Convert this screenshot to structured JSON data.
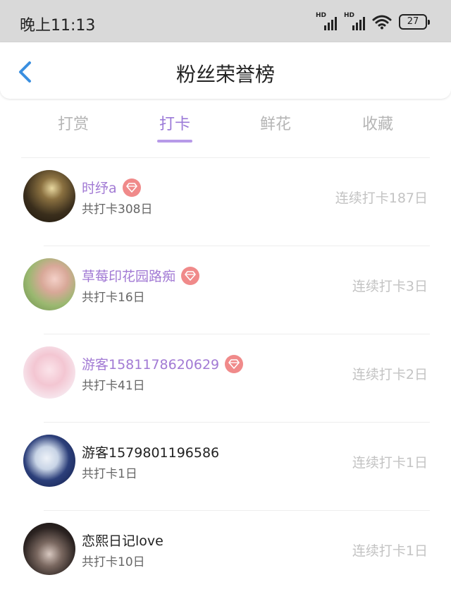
{
  "status": {
    "time": "晚上11:13",
    "battery": "27",
    "sim1": "HD",
    "sim2": "HD"
  },
  "header": {
    "title": "粉丝荣誉榜"
  },
  "tabs": [
    {
      "label": "打赏",
      "active": false
    },
    {
      "label": "打卡",
      "active": true
    },
    {
      "label": "鲜花",
      "active": false
    },
    {
      "label": "收藏",
      "active": false
    }
  ],
  "colors": {
    "accent": "#9b7ad8",
    "vip_name": "#a27ad4",
    "badge": "#f08a8a"
  },
  "fans": [
    {
      "name": "时纾a",
      "total": "共打卡308日",
      "streak": "连续打卡187日",
      "vip": true
    },
    {
      "name": "草莓印花园路痴",
      "total": "共打卡16日",
      "streak": "连续打卡3日",
      "vip": true
    },
    {
      "name": "游客1581178620629",
      "total": "共打卡41日",
      "streak": "连续打卡2日",
      "vip": true
    },
    {
      "name": "游客1579801196586",
      "total": "共打卡1日",
      "streak": "连续打卡1日",
      "vip": false
    },
    {
      "name": "恋熙日记love",
      "total": "共打卡10日",
      "streak": "连续打卡1日",
      "vip": false
    }
  ]
}
